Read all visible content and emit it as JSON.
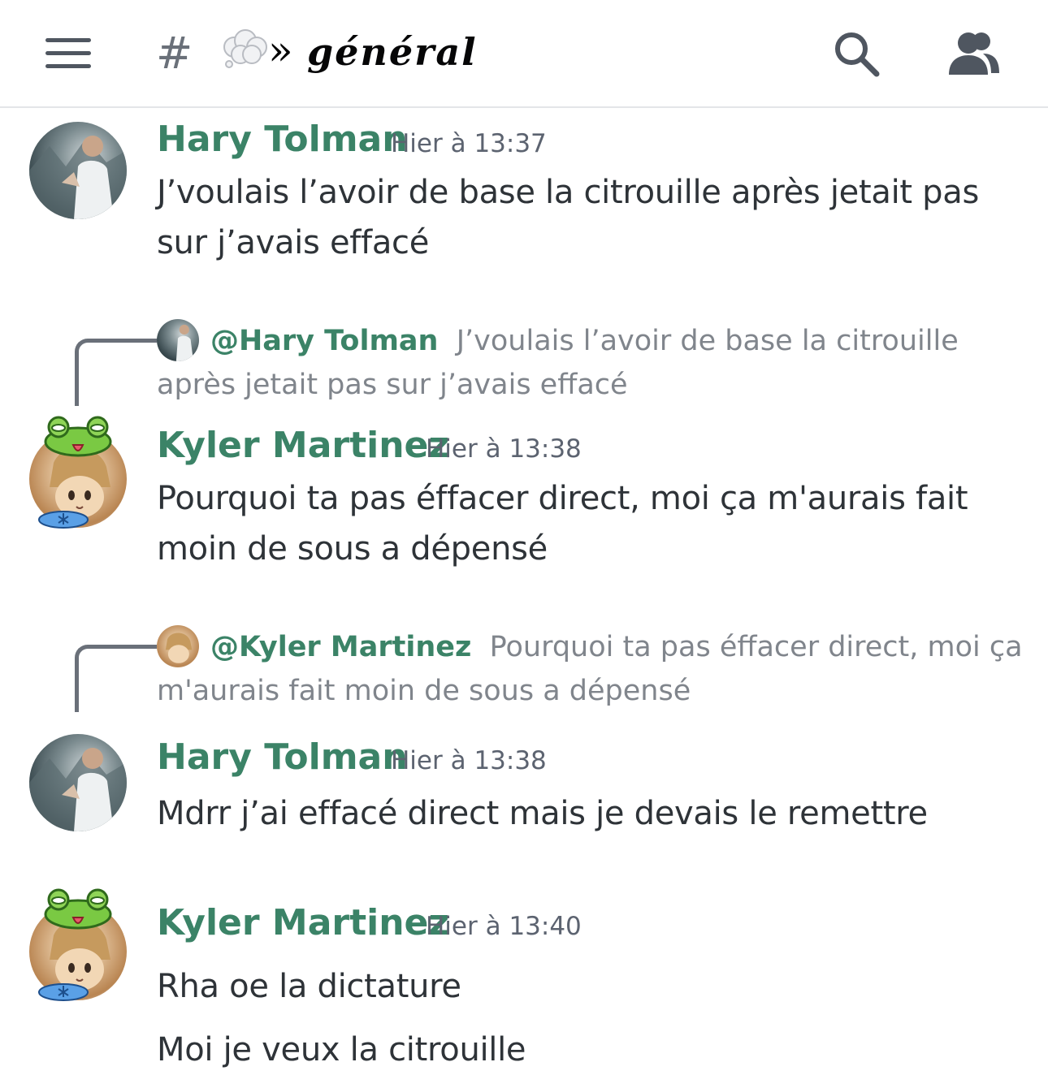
{
  "header": {
    "hash": "#",
    "channel_separator": "»",
    "channel_name": "𝒈𝒆́𝒏𝒆́𝒓𝒂𝒍",
    "icons": {
      "menu": "hamburger-icon",
      "cloud": "thought-cloud-emoji",
      "search": "search-icon",
      "members": "members-icon"
    }
  },
  "messages": [
    {
      "author": "Hary Tolman",
      "timestamp": "Hier à 13:37",
      "lines": [
        "J’voulais l’avoir de base la citrouille après jetait pas",
        "sur j’avais effacé"
      ]
    },
    {
      "reply_to": {
        "mention": "@Hary Tolman",
        "text_first": "J’voulais l’avoir de base la citrouille",
        "text_second": "après jetait pas sur j’avais effacé"
      },
      "author": "Kyler Martinez",
      "timestamp": "Hier à 13:38",
      "lines": [
        "Pourquoi ta pas éffacer direct, moi ça m'aurais fait",
        "moin de sous a dépensé"
      ]
    },
    {
      "reply_to": {
        "mention": "@Kyler Martinez",
        "text_first": "Pourquoi ta pas éffacer direct, moi ça",
        "text_second": "m'aurais fait moin de sous a dépensé"
      },
      "author": "Hary Tolman",
      "timestamp": "Hier à 13:38",
      "lines": [
        "Mdrr j’ai effacé direct mais je devais le remettre"
      ]
    },
    {
      "author": "Kyler Martinez",
      "timestamp": "Hier à 13:40",
      "lines": [
        "Rha oe la dictature",
        "Moi je veux la citrouille"
      ]
    }
  ],
  "colors": {
    "author": "#3b8367",
    "text": "#2e3338",
    "muted": "#80858c",
    "timestamp": "#5c6370"
  }
}
